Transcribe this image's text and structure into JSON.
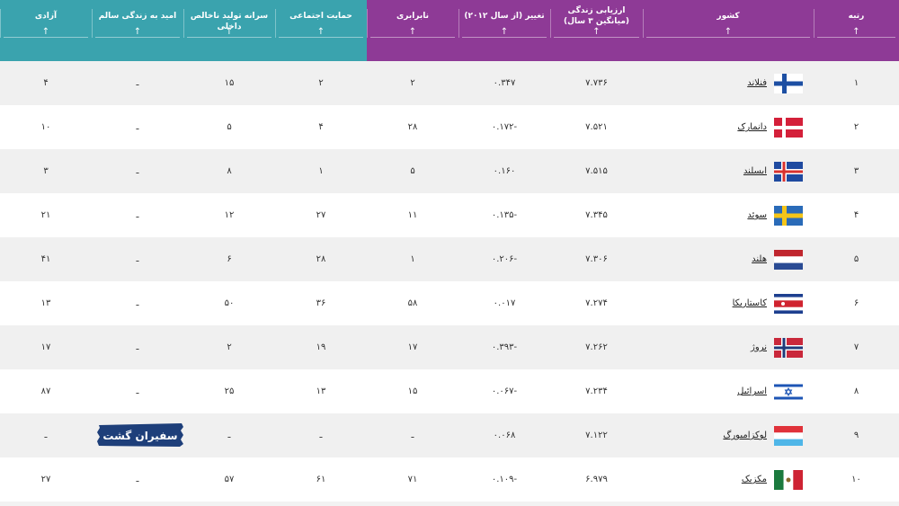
{
  "colors": {
    "header_purple": "#8e3a96",
    "header_teal": "#3aa3ae",
    "row_shade": "#f0f0f0",
    "row_white": "#ffffff"
  },
  "header": {
    "rank": "رتبه",
    "country": "کشور",
    "score": "ارزیابی زندگی (میانگین ۳ سال)",
    "change": "تغییر (از سال ۲۰۱۲)",
    "equality": "نابرابری",
    "social_support": "حمایت اجتماعی",
    "gdp": "سرانه تولید ناخالص داخلی",
    "life_expectancy": "امید به زندگی سالم",
    "freedom": "آزادی",
    "sort_icon": "↑"
  },
  "rows": [
    {
      "rank": "۱",
      "country": "فنلاند",
      "flag": "finland-flag",
      "score": "۷.۷۳۶",
      "change": "۰.۳۴۷",
      "equality": "۲",
      "social": "۲",
      "gdp": "۱۵",
      "life": "ـ",
      "freedom": "۴"
    },
    {
      "rank": "۲",
      "country": "دانمارک",
      "flag": "denmark-flag",
      "score": "۷.۵۲۱",
      "change": "-۰.۱۷۲",
      "equality": "۲۸",
      "social": "۴",
      "gdp": "۵",
      "life": "ـ",
      "freedom": "۱۰"
    },
    {
      "rank": "۳",
      "country": "ایسلند",
      "flag": "iceland-flag",
      "score": "۷.۵۱۵",
      "change": "۰.۱۶۰",
      "equality": "۵",
      "social": "۱",
      "gdp": "۸",
      "life": "ـ",
      "freedom": "۳"
    },
    {
      "rank": "۴",
      "country": "سوئد",
      "flag": "sweden-flag",
      "score": "۷.۳۴۵",
      "change": "-۰.۱۳۵",
      "equality": "۱۱",
      "social": "۲۷",
      "gdp": "۱۲",
      "life": "ـ",
      "freedom": "۲۱"
    },
    {
      "rank": "۵",
      "country": "هلند",
      "flag": "netherlands-flag",
      "score": "۷.۳۰۶",
      "change": "-۰.۲۰۶",
      "equality": "۱",
      "social": "۲۸",
      "gdp": "۶",
      "life": "ـ",
      "freedom": "۴۱"
    },
    {
      "rank": "۶",
      "country": "کاستاریکا",
      "flag": "costa-rica-flag",
      "score": "۷.۲۷۴",
      "change": "۰.۰۱۷",
      "equality": "۵۸",
      "social": "۳۶",
      "gdp": "۵۰",
      "life": "ـ",
      "freedom": "۱۳"
    },
    {
      "rank": "۷",
      "country": "نروژ",
      "flag": "norway-flag",
      "score": "۷.۲۶۲",
      "change": "-۰.۳۹۳",
      "equality": "۱۷",
      "social": "۱۹",
      "gdp": "۲",
      "life": "ـ",
      "freedom": "۱۷"
    },
    {
      "rank": "۸",
      "country": "اسرائیل",
      "flag": "israel-flag",
      "score": "۷.۲۳۴",
      "change": "-۰.۰۶۷",
      "equality": "۱۵",
      "social": "۱۳",
      "gdp": "۲۵",
      "life": "ـ",
      "freedom": "۸۷"
    },
    {
      "rank": "۹",
      "country": "لوکزامبورگ",
      "flag": "luxembourg-flag",
      "score": "۷.۱۲۲",
      "change": "۰.۰۶۸",
      "equality": "ـ",
      "social": "ـ",
      "gdp": "ـ",
      "life": "ـ",
      "freedom": "ـ"
    },
    {
      "rank": "۱۰",
      "country": "مکزیک",
      "flag": "mexico-flag",
      "score": "۶.۹۷۹",
      "change": "-۰.۱۰۹",
      "equality": "۷۱",
      "social": "۶۱",
      "gdp": "۵۷",
      "life": "ـ",
      "freedom": "۲۷"
    }
  ],
  "watermark": {
    "text": "سفیران گشت"
  }
}
